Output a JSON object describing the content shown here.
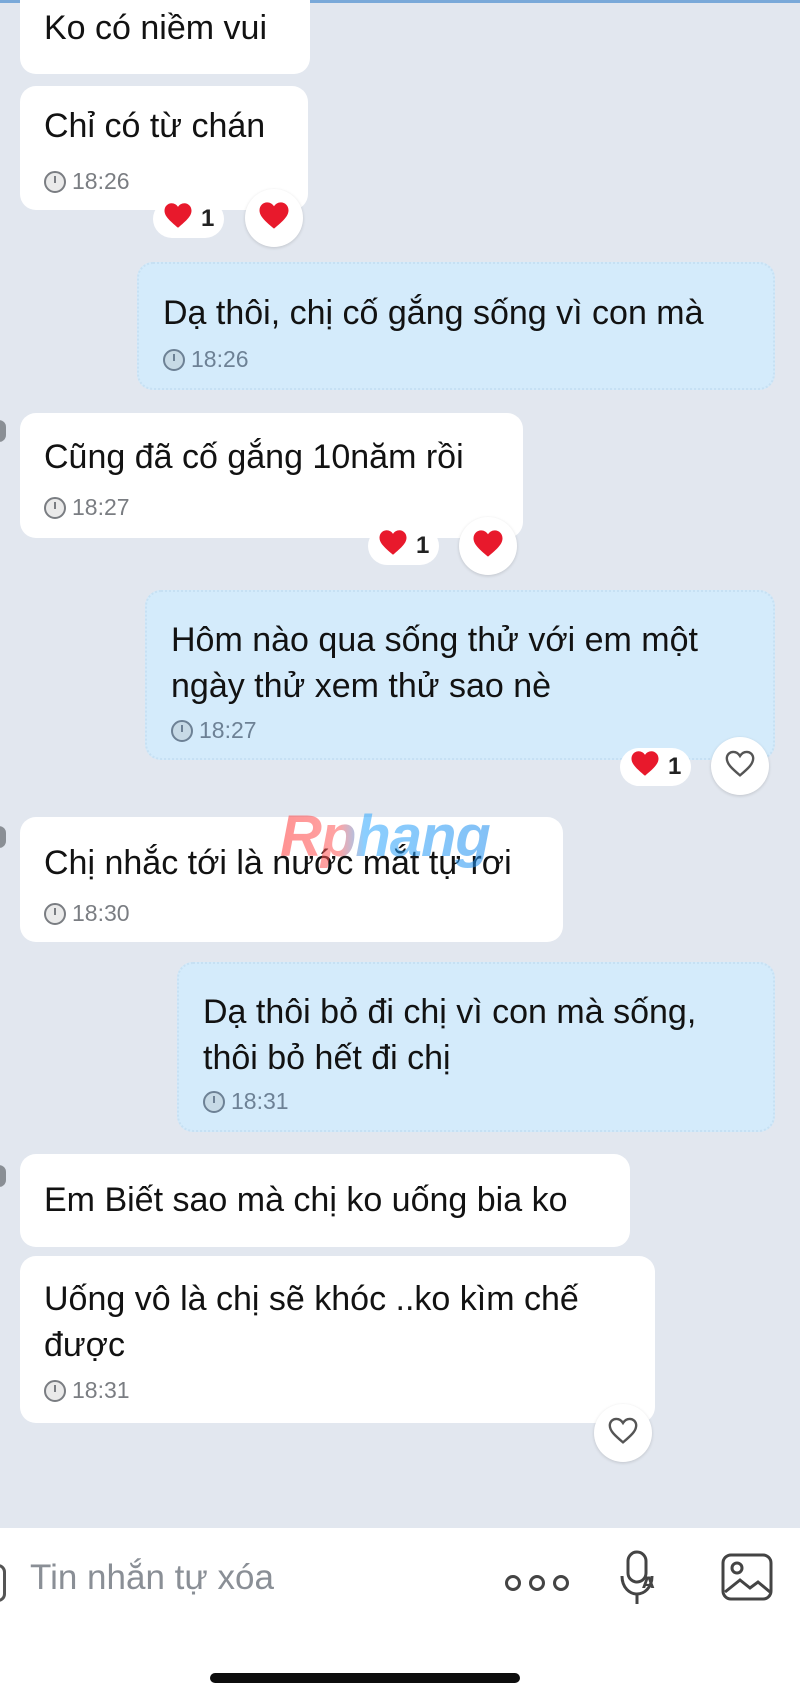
{
  "messages": [
    {
      "text": "Ko có niềm vui",
      "time": ""
    },
    {
      "text": "Chỉ có từ chán",
      "time": "18:26",
      "reaction_count": "1"
    },
    {
      "text": "Dạ thôi, chị cố gắng sống vì con mà",
      "time": "18:26"
    },
    {
      "text": "Cũng đã cố gắng 10năm rồi",
      "time": "18:27",
      "reaction_count": "1"
    },
    {
      "text": "Hôm nào qua sống thử với em một\nngày thử xem thử sao nè",
      "time": "18:27",
      "reaction_count": "1"
    },
    {
      "text": "Chị nhắc tới là nước mắt tự rơi",
      "time": "18:30"
    },
    {
      "text": "Dạ thôi bỏ đi chị vì con mà sống,\nthôi bỏ hết đi chị",
      "time": "18:31"
    },
    {
      "text": "Em Biết sao mà chị ko uống bia ko",
      "time": ""
    },
    {
      "text": "Uống vô là chị sẽ khóc ..ko kìm chế\nđược",
      "time": "18:31"
    }
  ],
  "watermark": "Rphang",
  "composer": {
    "placeholder": "Tin nhắn tự xóa"
  },
  "icons": {
    "reaction": "heart-icon",
    "time": "clock-icon",
    "more": "more-options-icon",
    "voice": "voice-to-text-icon",
    "image": "image-icon"
  },
  "colors": {
    "background": "#e2e7ef",
    "incoming_bubble": "#ffffff",
    "outgoing_bubble": "#d4ebfb",
    "heart": "#e8192c"
  }
}
